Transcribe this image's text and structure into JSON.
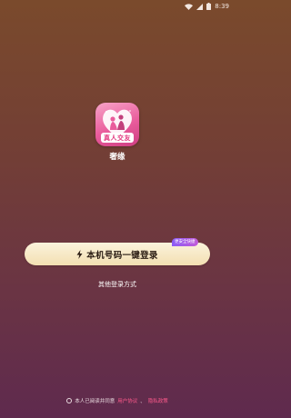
{
  "status_bar": {
    "time": "8:39",
    "icons": [
      "wifi-icon",
      "signal-icon",
      "battery-icon"
    ]
  },
  "app": {
    "logo_text": "真人交友",
    "name": "奢缘"
  },
  "login": {
    "one_click_label": "本机号码一键登录",
    "badge_text": "更安全快捷",
    "other_methods_label": "其他登录方式"
  },
  "agreement": {
    "prefix": "本人已阅读并同意",
    "user_agreement": "用户协议",
    "separator": "、",
    "privacy_policy": "隐私政策",
    "checked": false
  },
  "colors": {
    "background_top": "#7a4a2c",
    "background_bottom": "#5f2a4e",
    "button_gradient_start": "#fbf3dc",
    "button_gradient_end": "#f3dfb2",
    "link": "#ff5a8c",
    "logo_pink": "#e95c9c"
  }
}
